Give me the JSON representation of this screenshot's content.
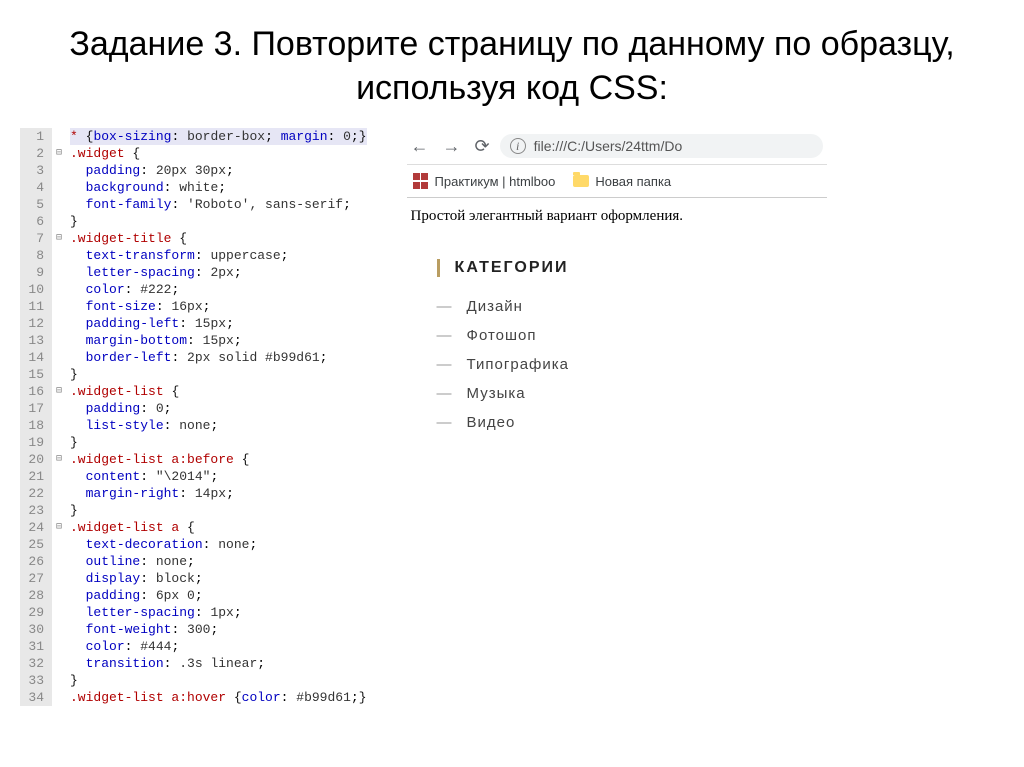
{
  "slide_title": "Задание 3. Повторите страницу по данному по образцу, используя код CSS:",
  "code_lines": [
    {
      "n": 1,
      "f": "",
      "html": "<span class='sel'>*</span> <span class='punct'>{</span><span class='prop'>box-sizing</span>: <span class='val'>border-box</span>; <span class='prop'>margin</span>: <span class='val'>0</span>;<span class='punct'>}</span>",
      "first": true
    },
    {
      "n": 2,
      "f": "⊟",
      "html": "<span class='sel'>.widget</span> <span class='punct'>{</span>"
    },
    {
      "n": 3,
      "f": "",
      "html": "  <span class='prop'>padding</span>: <span class='val'>20px 30px</span>;"
    },
    {
      "n": 4,
      "f": "",
      "html": "  <span class='prop'>background</span>: <span class='val'>white</span>;"
    },
    {
      "n": 5,
      "f": "",
      "html": "  <span class='prop'>font-family</span>: <span class='val'>'Roboto', sans-serif</span>;"
    },
    {
      "n": 6,
      "f": "",
      "html": "<span class='punct'>}</span>"
    },
    {
      "n": 7,
      "f": "⊟",
      "html": "<span class='sel'>.widget-title</span> <span class='punct'>{</span>"
    },
    {
      "n": 8,
      "f": "",
      "html": "  <span class='prop'>text-transform</span>: <span class='val'>uppercase</span>;"
    },
    {
      "n": 9,
      "f": "",
      "html": "  <span class='prop'>letter-spacing</span>: <span class='val'>2px</span>;"
    },
    {
      "n": 10,
      "f": "",
      "html": "  <span class='prop'>color</span>: <span class='val'>#222</span>;"
    },
    {
      "n": 11,
      "f": "",
      "html": "  <span class='prop'>font-size</span>: <span class='val'>16px</span>;"
    },
    {
      "n": 12,
      "f": "",
      "html": "  <span class='prop'>padding-left</span>: <span class='val'>15px</span>;"
    },
    {
      "n": 13,
      "f": "",
      "html": "  <span class='prop'>margin-bottom</span>: <span class='val'>15px</span>;"
    },
    {
      "n": 14,
      "f": "",
      "html": "  <span class='prop'>border-left</span>: <span class='val'>2px solid #b99d61</span>;"
    },
    {
      "n": 15,
      "f": "",
      "html": "<span class='punct'>}</span>"
    },
    {
      "n": 16,
      "f": "⊟",
      "html": "<span class='sel'>.widget-list</span> <span class='punct'>{</span>"
    },
    {
      "n": 17,
      "f": "",
      "html": "  <span class='prop'>padding</span>: <span class='val'>0</span>;"
    },
    {
      "n": 18,
      "f": "",
      "html": "  <span class='prop'>list-style</span>: <span class='val'>none</span>;"
    },
    {
      "n": 19,
      "f": "",
      "html": "<span class='punct'>}</span>"
    },
    {
      "n": 20,
      "f": "⊟",
      "html": "<span class='sel'>.widget-list a:before</span> <span class='punct'>{</span>"
    },
    {
      "n": 21,
      "f": "",
      "html": "  <span class='prop'>content</span>: <span class='val'>\"\\2014\"</span>;"
    },
    {
      "n": 22,
      "f": "",
      "html": "  <span class='prop'>margin-right</span>: <span class='val'>14px</span>;"
    },
    {
      "n": 23,
      "f": "",
      "html": "<span class='punct'>}</span>"
    },
    {
      "n": 24,
      "f": "⊟",
      "html": "<span class='sel'>.widget-list a</span> <span class='punct'>{</span>"
    },
    {
      "n": 25,
      "f": "",
      "html": "  <span class='prop'>text-decoration</span>: <span class='val'>none</span>;"
    },
    {
      "n": 26,
      "f": "",
      "html": "  <span class='prop'>outline</span>: <span class='val'>none</span>;"
    },
    {
      "n": 27,
      "f": "",
      "html": "  <span class='prop'>display</span>: <span class='val'>block</span>;"
    },
    {
      "n": 28,
      "f": "",
      "html": "  <span class='prop'>padding</span>: <span class='val'>6px 0</span>;"
    },
    {
      "n": 29,
      "f": "",
      "html": "  <span class='prop'>letter-spacing</span>: <span class='val'>1px</span>;"
    },
    {
      "n": 30,
      "f": "",
      "html": "  <span class='prop'>font-weight</span>: <span class='val'>300</span>;"
    },
    {
      "n": 31,
      "f": "",
      "html": "  <span class='prop'>color</span>: <span class='val'>#444</span>;"
    },
    {
      "n": 32,
      "f": "",
      "html": "  <span class='prop'>transition</span>: <span class='val'>.3s linear</span>;"
    },
    {
      "n": 33,
      "f": "",
      "html": "<span class='punct'>}</span>"
    },
    {
      "n": 34,
      "f": "",
      "html": "<span class='sel'>.widget-list a:hover</span> <span class='punct'>{</span><span class='prop'>color</span>: <span class='val'>#b99d61</span>;<span class='punct'>}</span>"
    }
  ],
  "browser": {
    "url": "file:///C:/Users/24ttm/Do",
    "bookmarks": [
      {
        "icon": "grid",
        "label": "Практикум | htmlboo"
      },
      {
        "icon": "folder",
        "label": "Новая папка"
      }
    ],
    "caption": "Простой элегантный вариант оформления."
  },
  "widget": {
    "title": "КАТЕГОРИИ",
    "items": [
      "Дизайн",
      "Фотошоп",
      "Типографика",
      "Музыка",
      "Видео"
    ]
  }
}
